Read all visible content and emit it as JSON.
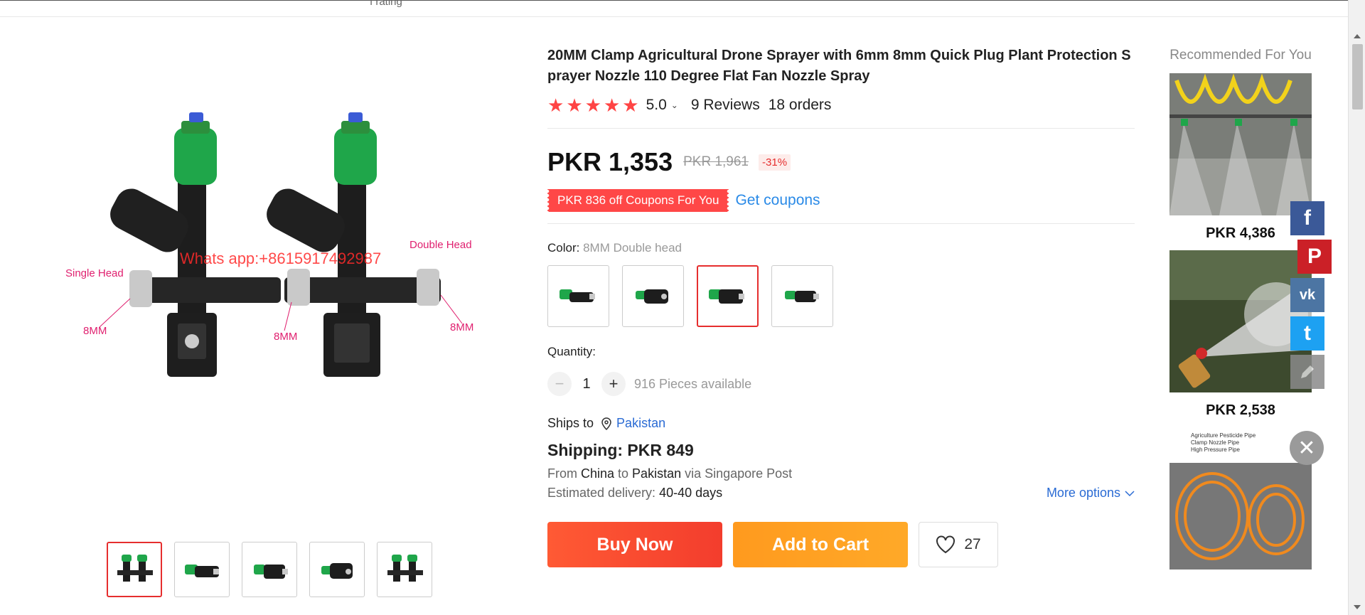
{
  "topbar": {
    "text": "ı rating"
  },
  "gallery": {
    "watermark": "Whats app:+8615917492987",
    "labels": {
      "single_head": "Single Head",
      "double_head": "Double Head",
      "mm_left": "8MM",
      "mm_mid": "8MM",
      "mm_right": "8MM"
    },
    "thumbs": [
      "thumb-1",
      "thumb-2",
      "thumb-3",
      "thumb-4",
      "thumb-5"
    ]
  },
  "product": {
    "title": "20MM Clamp Agricultural Drone Sprayer with 6mm 8mm Quick Plug Plant Protection Sprayer Nozzle 110 Degree Flat Fan Nozzle Spray",
    "rating": "5.0",
    "caret": "⌄",
    "reviews": "9 Reviews",
    "orders": "18 orders",
    "star_count": 5,
    "price": "PKR 1,353",
    "old_price": "PKR 1,961",
    "discount": "-31%",
    "coupon": "PKR 836 off Coupons For You",
    "get_coupons": "Get coupons",
    "color_label": "Color: ",
    "color_value": "8MM Double head",
    "selected_swatch": 3,
    "quantity_label": "Quantity:",
    "quantity": "1",
    "minus": "−",
    "plus": "+",
    "available": "916 Pieces available",
    "ships_to_label": "Ships to",
    "ships_to_country": "Pakistan",
    "shipping": "Shipping: PKR 849",
    "from_label": "From ",
    "from_country": "China",
    "to_label": " to ",
    "to_country": "Pakistan",
    "via": " via Singapore Post",
    "estimated_label": "Estimated delivery: ",
    "estimated_value": "40-40 days",
    "more_options": "More options",
    "buy_now": "Buy Now",
    "add_to_cart": "Add to Cart",
    "wishlist_count": "27"
  },
  "recommended": {
    "title": "Recommended For You",
    "items": [
      {
        "price": "PKR 4,386"
      },
      {
        "price": "PKR 2,538"
      },
      {
        "caption": [
          "Agriculture Pesticide Pipe",
          "Clamp Nozzle Pipe",
          "High Pressure Pipe"
        ]
      }
    ]
  },
  "social": {
    "facebook": "f",
    "pinterest": "P",
    "vk": "vk",
    "twitter": "t",
    "close": "✕"
  },
  "colors": {
    "accent": "#e62e2e",
    "link": "#2a8ae7",
    "buy": "#f33d2d",
    "cart": "#ffa928",
    "star": "#ff4444"
  }
}
